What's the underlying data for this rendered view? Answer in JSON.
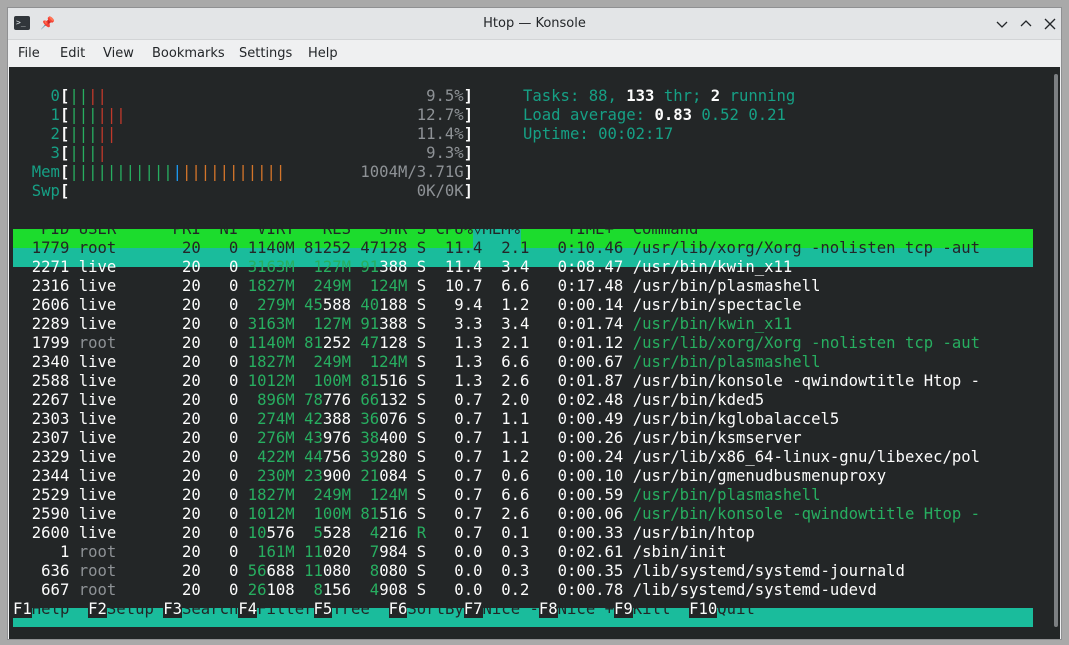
{
  "window": {
    "title": "Htop — Konsole",
    "app_icon_glyph": ">_",
    "pin_glyph": "📌"
  },
  "menu": {
    "items": [
      "File",
      "Edit",
      "View",
      "Bookmarks",
      "Settings",
      "Help"
    ]
  },
  "meters": {
    "cpus": [
      {
        "label": "0",
        "bars": [
          {
            "t": "||",
            "c": "green"
          },
          {
            "t": "||",
            "c": "red"
          }
        ],
        "pct": "9.5%"
      },
      {
        "label": "1",
        "bars": [
          {
            "t": "|||",
            "c": "green"
          },
          {
            "t": "|||",
            "c": "red"
          }
        ],
        "pct": "12.7%"
      },
      {
        "label": "2",
        "bars": [
          {
            "t": "|||",
            "c": "green"
          },
          {
            "t": "||",
            "c": "red"
          }
        ],
        "pct": "11.4%"
      },
      {
        "label": "3",
        "bars": [
          {
            "t": "|||",
            "c": "green"
          },
          {
            "t": "|",
            "c": "red"
          }
        ],
        "pct": "9.3%"
      }
    ],
    "mem": {
      "label": "Mem",
      "bars": [
        {
          "t": "|||||||||||",
          "c": "green"
        },
        {
          "t": "|",
          "c": "blue"
        },
        {
          "t": "|||||||||||",
          "c": "orange"
        }
      ],
      "value": "1004M/3.71G"
    },
    "swp": {
      "label": "Swp",
      "value": "0K/0K"
    }
  },
  "summary": {
    "tasks_label": "Tasks:",
    "tasks": "88",
    "thr": "133",
    "thr_label": "thr;",
    "running": "2",
    "running_label": "running",
    "load_label": "Load average:",
    "load1": "0.83",
    "load5": "0.52",
    "load15": "0.21",
    "uptime_label": "Uptime:",
    "uptime": "00:02:17"
  },
  "table": {
    "columns": {
      "pid": "PID",
      "user": "USER",
      "pri": "PRI",
      "ni": "NI",
      "virt": "VIRT",
      "res": "RES",
      "shr": "SHR",
      "s": "S",
      "cpu": "CPU%▽",
      "mem": "MEM%",
      "time": "TIME+",
      "command": "Command"
    },
    "rows": [
      {
        "pid": "1779",
        "user": "root",
        "pri": "20",
        "ni": "0",
        "virt": "1140M",
        "res": "81252",
        "shr": "47128",
        "s": "S",
        "cpu": "11.4",
        "mem": "2.1",
        "time": "0:10.46",
        "cmd": "/usr/lib/xorg/Xorg -nolisten tcp -aut",
        "selected": true
      },
      {
        "pid": "2271",
        "user": "live",
        "pri": "20",
        "ni": "0",
        "virt": "3163M",
        "res": "127M",
        "shr": "91388",
        "s": "S",
        "cpu": "11.4",
        "mem": "3.4",
        "time": "0:08.47",
        "cmd": "/usr/bin/kwin_x11"
      },
      {
        "pid": "2316",
        "user": "live",
        "pri": "20",
        "ni": "0",
        "virt": "1827M",
        "res": "249M",
        "shr": "124M",
        "s": "S",
        "cpu": "10.7",
        "mem": "6.6",
        "time": "0:17.48",
        "cmd": "/usr/bin/plasmashell"
      },
      {
        "pid": "2606",
        "user": "live",
        "pri": "20",
        "ni": "0",
        "virt": "279M",
        "res": "45588",
        "shr": "40188",
        "s": "S",
        "cpu": "9.4",
        "mem": "1.2",
        "time": "0:00.14",
        "cmd": "/usr/bin/spectacle"
      },
      {
        "pid": "2289",
        "user": "live",
        "pri": "20",
        "ni": "0",
        "virt": "3163M",
        "res": "127M",
        "shr": "91388",
        "s": "S",
        "cpu": "3.3",
        "mem": "3.4",
        "time": "0:01.74",
        "cmd": "/usr/bin/kwin_x11",
        "thread": true
      },
      {
        "pid": "1799",
        "user": "root",
        "pri": "20",
        "ni": "0",
        "virt": "1140M",
        "res": "81252",
        "shr": "47128",
        "s": "S",
        "cpu": "1.3",
        "mem": "2.1",
        "time": "0:01.12",
        "cmd": "/usr/lib/xorg/Xorg -nolisten tcp -aut",
        "thread": true
      },
      {
        "pid": "2340",
        "user": "live",
        "pri": "20",
        "ni": "0",
        "virt": "1827M",
        "res": "249M",
        "shr": "124M",
        "s": "S",
        "cpu": "1.3",
        "mem": "6.6",
        "time": "0:00.67",
        "cmd": "/usr/bin/plasmashell",
        "thread": true
      },
      {
        "pid": "2588",
        "user": "live",
        "pri": "20",
        "ni": "0",
        "virt": "1012M",
        "res": "100M",
        "shr": "81516",
        "s": "S",
        "cpu": "1.3",
        "mem": "2.6",
        "time": "0:01.87",
        "cmd": "/usr/bin/konsole -qwindowtitle Htop -"
      },
      {
        "pid": "2267",
        "user": "live",
        "pri": "20",
        "ni": "0",
        "virt": "896M",
        "res": "78776",
        "shr": "66132",
        "s": "S",
        "cpu": "0.7",
        "mem": "2.0",
        "time": "0:02.48",
        "cmd": "/usr/bin/kded5"
      },
      {
        "pid": "2303",
        "user": "live",
        "pri": "20",
        "ni": "0",
        "virt": "274M",
        "res": "42388",
        "shr": "36076",
        "s": "S",
        "cpu": "0.7",
        "mem": "1.1",
        "time": "0:00.49",
        "cmd": "/usr/bin/kglobalaccel5"
      },
      {
        "pid": "2307",
        "user": "live",
        "pri": "20",
        "ni": "0",
        "virt": "276M",
        "res": "43976",
        "shr": "38400",
        "s": "S",
        "cpu": "0.7",
        "mem": "1.1",
        "time": "0:00.26",
        "cmd": "/usr/bin/ksmserver"
      },
      {
        "pid": "2329",
        "user": "live",
        "pri": "20",
        "ni": "0",
        "virt": "422M",
        "res": "44756",
        "shr": "39280",
        "s": "S",
        "cpu": "0.7",
        "mem": "1.2",
        "time": "0:00.24",
        "cmd": "/usr/lib/x86_64-linux-gnu/libexec/pol"
      },
      {
        "pid": "2344",
        "user": "live",
        "pri": "20",
        "ni": "0",
        "virt": "230M",
        "res": "23900",
        "shr": "21084",
        "s": "S",
        "cpu": "0.7",
        "mem": "0.6",
        "time": "0:00.10",
        "cmd": "/usr/bin/gmenudbusmenuproxy"
      },
      {
        "pid": "2529",
        "user": "live",
        "pri": "20",
        "ni": "0",
        "virt": "1827M",
        "res": "249M",
        "shr": "124M",
        "s": "S",
        "cpu": "0.7",
        "mem": "6.6",
        "time": "0:00.59",
        "cmd": "/usr/bin/plasmashell",
        "thread": true
      },
      {
        "pid": "2590",
        "user": "live",
        "pri": "20",
        "ni": "0",
        "virt": "1012M",
        "res": "100M",
        "shr": "81516",
        "s": "S",
        "cpu": "0.7",
        "mem": "2.6",
        "time": "0:00.06",
        "cmd": "/usr/bin/konsole -qwindowtitle Htop -",
        "thread": true
      },
      {
        "pid": "2600",
        "user": "live",
        "pri": "20",
        "ni": "0",
        "virt": "10576",
        "res": "5528",
        "shr": "4216",
        "s": "R",
        "cpu": "0.7",
        "mem": "0.1",
        "time": "0:00.33",
        "cmd": "/usr/bin/htop"
      },
      {
        "pid": "1",
        "user": "root",
        "pri": "20",
        "ni": "0",
        "virt": "161M",
        "res": "11020",
        "shr": "7984",
        "s": "S",
        "cpu": "0.0",
        "mem": "0.3",
        "time": "0:02.61",
        "cmd": "/sbin/init"
      },
      {
        "pid": "636",
        "user": "root",
        "pri": "20",
        "ni": "0",
        "virt": "56688",
        "res": "11080",
        "shr": "8080",
        "s": "S",
        "cpu": "0.0",
        "mem": "0.3",
        "time": "0:00.35",
        "cmd": "/lib/systemd/systemd-journald"
      },
      {
        "pid": "667",
        "user": "root",
        "pri": "20",
        "ni": "0",
        "virt": "26108",
        "res": "8156",
        "shr": "4908",
        "s": "S",
        "cpu": "0.0",
        "mem": "0.2",
        "time": "0:00.78",
        "cmd": "/lib/systemd/systemd-udevd"
      }
    ]
  },
  "fkeys": [
    {
      "key": "F1",
      "label": "Help"
    },
    {
      "key": "F2",
      "label": "Setup"
    },
    {
      "key": "F3",
      "label": "Search"
    },
    {
      "key": "F4",
      "label": "Filter"
    },
    {
      "key": "F5",
      "label": "Tree"
    },
    {
      "key": "F6",
      "label": "SortBy"
    },
    {
      "key": "F7",
      "label": "Nice -"
    },
    {
      "key": "F8",
      "label": "Nice +"
    },
    {
      "key": "F9",
      "label": "Kill"
    },
    {
      "key": "F10",
      "label": "Quit"
    }
  ],
  "colors": {
    "terminal_bg": "#232627",
    "header_row": "#1cdc2d",
    "selected_row": "#1abc9c",
    "text": "#fcfcfc",
    "teal": "#16a085",
    "green": "#27ae60",
    "red": "#c0392b",
    "blue": "#1d99f3",
    "orange": "#d4752a",
    "gray": "#8e9296"
  }
}
